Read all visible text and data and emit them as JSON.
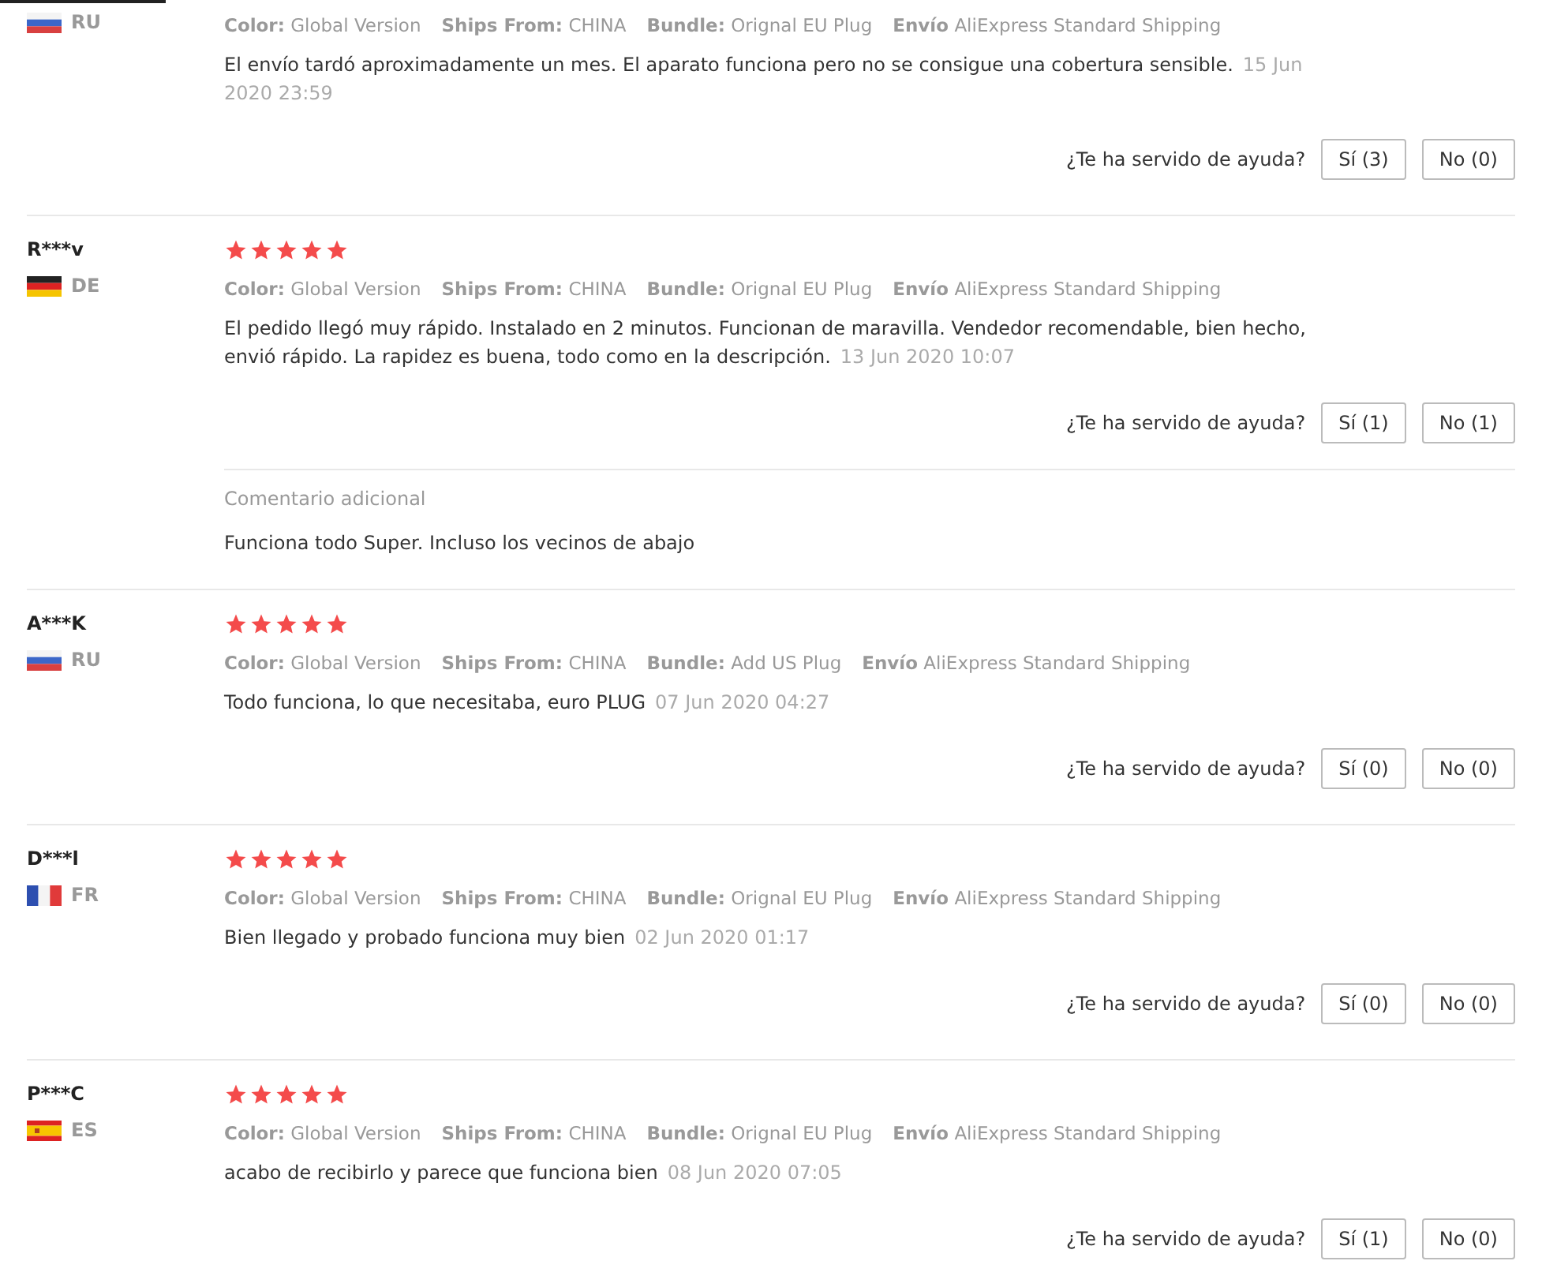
{
  "reviews": [
    {
      "country": "RU",
      "flag": {
        "kind": "russia"
      },
      "attributes": [
        {
          "label": "Color:",
          "value": "Global Version"
        },
        {
          "label": "Ships From:",
          "value": "CHINA"
        },
        {
          "label": "Bundle:",
          "value": "Orignal EU Plug"
        },
        {
          "label": "Envío",
          "value": "AliExpress Standard Shipping"
        }
      ],
      "text": "El envío tardó aproximadamente un mes. El aparato funciona pero no se consigue una cobertura sensible.",
      "date": "15 Jun 2020 23:59",
      "helpful_prompt": "¿Te ha servido de ayuda?",
      "yes_button": "Sí (3)",
      "no_button": "No (0)"
    },
    {
      "name": "R***v",
      "country": "DE",
      "flag": {
        "kind": "germany"
      },
      "stars": 5,
      "attributes": [
        {
          "label": "Color:",
          "value": "Global Version"
        },
        {
          "label": "Ships From:",
          "value": "CHINA"
        },
        {
          "label": "Bundle:",
          "value": "Orignal EU Plug"
        },
        {
          "label": "Envío",
          "value": "AliExpress Standard Shipping"
        }
      ],
      "text": "El pedido llegó muy rápido. Instalado en 2 minutos. Funcionan de maravilla. Vendedor recomendable, bien hecho, envió rápido. La rapidez es buena, todo como en la descripción.",
      "date": "13 Jun 2020 10:07",
      "helpful_prompt": "¿Te ha servido de ayuda?",
      "yes_button": "Sí (1)",
      "no_button": "No (1)",
      "additional": {
        "title": "Comentario adicional",
        "text": "Funciona todo Super. Incluso los vecinos de abajo"
      }
    },
    {
      "name": "A***K",
      "country": "RU",
      "flag": {
        "kind": "russia"
      },
      "stars": 5,
      "attributes": [
        {
          "label": "Color:",
          "value": "Global Version"
        },
        {
          "label": "Ships From:",
          "value": "CHINA"
        },
        {
          "label": "Bundle:",
          "value": "Add US Plug"
        },
        {
          "label": "Envío",
          "value": "AliExpress Standard Shipping"
        }
      ],
      "text": "Todo funciona, lo que necesitaba, euro PLUG",
      "date": "07 Jun 2020 04:27",
      "helpful_prompt": "¿Te ha servido de ayuda?",
      "yes_button": "Sí (0)",
      "no_button": "No (0)"
    },
    {
      "name": "D***l",
      "country": "FR",
      "flag": {
        "kind": "france"
      },
      "stars": 5,
      "attributes": [
        {
          "label": "Color:",
          "value": "Global Version"
        },
        {
          "label": "Ships From:",
          "value": "CHINA"
        },
        {
          "label": "Bundle:",
          "value": "Orignal EU Plug"
        },
        {
          "label": "Envío",
          "value": "AliExpress Standard Shipping"
        }
      ],
      "text": "Bien llegado y probado funciona muy bien",
      "date": "02 Jun 2020 01:17",
      "helpful_prompt": "¿Te ha servido de ayuda?",
      "yes_button": "Sí (0)",
      "no_button": "No (0)"
    },
    {
      "name": "P***C",
      "country": "ES",
      "flag": {
        "kind": "spain"
      },
      "stars": 5,
      "attributes": [
        {
          "label": "Color:",
          "value": "Global Version"
        },
        {
          "label": "Ships From:",
          "value": "CHINA"
        },
        {
          "label": "Bundle:",
          "value": "Orignal EU Plug"
        },
        {
          "label": "Envío",
          "value": "AliExpress Standard Shipping"
        }
      ],
      "text": "acabo de recibirlo y parece que funciona bien",
      "date": "08 Jun 2020 07:05",
      "helpful_prompt": "¿Te ha servido de ayuda?",
      "yes_button": "Sí (1)",
      "no_button": "No (0)"
    }
  ]
}
